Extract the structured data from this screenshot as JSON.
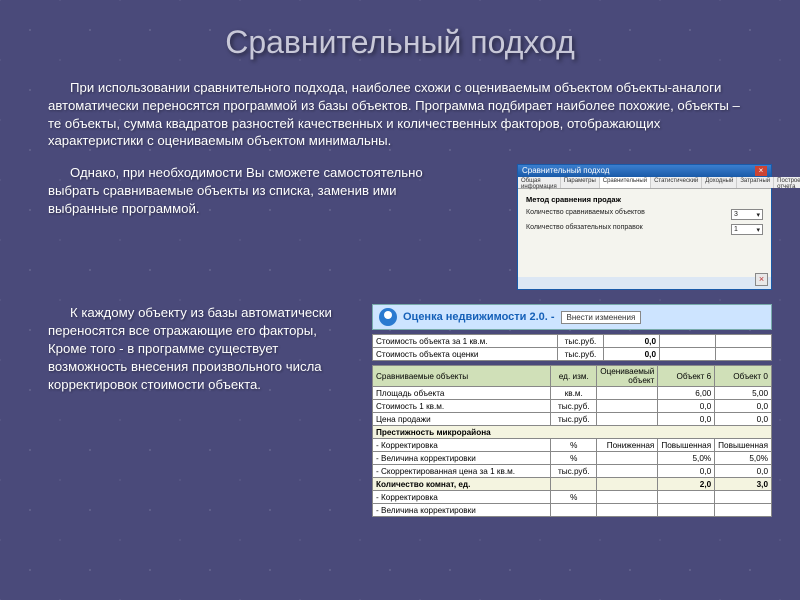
{
  "title": "Сравнительный подход",
  "para1": "При использовании сравнительного подхода, наиболее схожи с оцениваемым объектом объекты-аналоги автоматически переносятся программой из базы объектов. Программа подбирает наиболее похожие, объекты – те объекты, сумма квадратов разностей качественных и количественных факторов, отображающих характеристики с оцениваемым объектом минимальны.",
  "para2": "Однако, при необходимости Вы сможете самостоятельно выбрать сравниваемые объекты из списка, заменив ими выбранные программой.",
  "para3": "К каждому объекту из базы автоматически переносятся все отражающие его факторы, Кроме того - в программе существует возможность внесения произвольного числа корректировок стоимости объекта.",
  "dialog": {
    "title": "Сравнительный подход",
    "tabs": [
      "Общая информация",
      "Параметры",
      "Сравнительный",
      "Статистический",
      "Доходный",
      "Затратный",
      "Построение отчета"
    ],
    "heading": "Метод сравнения продаж",
    "row1_label": "Количество сравниваемых объектов",
    "row1_value": "3",
    "row2_label": "Количество обязательных поправок",
    "row2_value": "1"
  },
  "app": {
    "title": "Оценка недвижимости 2.0. -",
    "button": "Внести изменения"
  },
  "toprows": [
    {
      "label": "Стоимость объекта за 1 кв.м.",
      "unit": "тыс.руб.",
      "val": "0,0"
    },
    {
      "label": "Стоимость объекта оценки",
      "unit": "тыс.руб.",
      "val": "0,0"
    }
  ],
  "headers": [
    "Сравниваемые объекты",
    "ед. изм.",
    "Оцениваемый объект",
    "Объект 6",
    "Объект 0"
  ],
  "rows": [
    {
      "label": "Площадь объекта",
      "unit": "кв.м.",
      "a": "",
      "b": "6,00",
      "c": "5,00"
    },
    {
      "label": "Стоимость 1 кв.м.",
      "unit": "тыс.руб.",
      "a": "",
      "b": "0,0",
      "c": "0,0"
    },
    {
      "label": "Цена продажи",
      "unit": "тыс.руб.",
      "a": "",
      "b": "0,0",
      "c": "0,0"
    }
  ],
  "section1": "Престижность микрорайона",
  "rows2": [
    {
      "label": "- Корректировка",
      "unit": "%",
      "a": "Пониженная",
      "b": "Повышенная",
      "c": "Повышенная"
    },
    {
      "label": "- Величина корректировки",
      "unit": "%",
      "a": "",
      "b": "5,0%",
      "c": "5,0%"
    },
    {
      "label": "- Скорректированная цена за 1 кв.м.",
      "unit": "тыс.руб.",
      "a": "",
      "b": "0,0",
      "c": "0,0"
    }
  ],
  "section2": "Количество комнат, ед.",
  "rows3": [
    {
      "label": "",
      "unit": "",
      "a": "",
      "b": "2,0",
      "c": "3,0"
    },
    {
      "label": "- Корректировка",
      "unit": "%",
      "a": "",
      "b": "",
      "c": ""
    },
    {
      "label": "- Величина корректировки",
      "unit": "",
      "a": "",
      "b": "",
      "c": ""
    }
  ]
}
